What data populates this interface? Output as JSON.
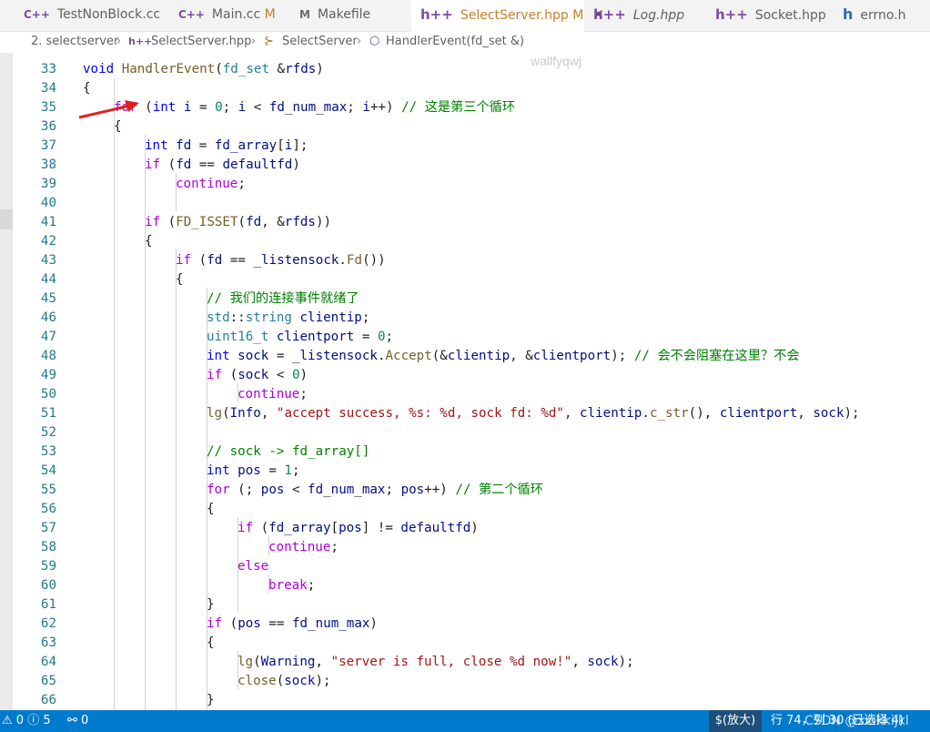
{
  "tabs": [
    {
      "icon": "C++",
      "label": "TestNonBlock.cc",
      "modified": ""
    },
    {
      "icon": "C++",
      "label": "Main.cc",
      "modified": "M"
    },
    {
      "icon": "M",
      "label": "Makefile",
      "modified": ""
    },
    {
      "icon": "h++",
      "label": "SelectServer.hpp",
      "modified": "M",
      "close": "✕"
    },
    {
      "icon": "h++",
      "label": "Log.hpp",
      "modified": ""
    },
    {
      "icon": "h++",
      "label": "Socket.hpp",
      "modified": ""
    },
    {
      "icon": "h",
      "label": "errno.h",
      "modified": ""
    }
  ],
  "breadcrumb": {
    "folder": "2. selectserver",
    "file": "SelectServer.hpp",
    "class": "SelectServer",
    "method": "HandlerEvent(fd_set &)"
  },
  "watermark": "wallfyqwj",
  "code_lines": [
    {
      "num": "33",
      "indent": 2,
      "tokens": [
        [
          "void",
          "k"
        ],
        [
          " ",
          ""
        ],
        [
          "HandlerEvent",
          "fn"
        ],
        [
          "(",
          ""
        ],
        [
          "fd_set",
          "ty"
        ],
        [
          " &",
          ""
        ],
        [
          "rfds",
          "v"
        ],
        [
          ")",
          ""
        ]
      ]
    },
    {
      "num": "34",
      "indent": 2,
      "tokens": [
        [
          "{",
          ""
        ]
      ]
    },
    {
      "num": "35",
      "indent": 3,
      "tokens": [
        [
          "for",
          "ctrl"
        ],
        [
          " (",
          ""
        ],
        [
          "int",
          "k"
        ],
        [
          " ",
          ""
        ],
        [
          "i",
          "v"
        ],
        [
          " = ",
          ""
        ],
        [
          "0",
          "n"
        ],
        [
          "; ",
          ""
        ],
        [
          "i",
          "v"
        ],
        [
          " < ",
          ""
        ],
        [
          "fd_num_max",
          "v"
        ],
        [
          "; ",
          ""
        ],
        [
          "i",
          "v"
        ],
        [
          "++) ",
          ""
        ],
        [
          "// 这是第三个循环",
          "c"
        ]
      ]
    },
    {
      "num": "36",
      "indent": 3,
      "tokens": [
        [
          "{",
          ""
        ]
      ]
    },
    {
      "num": "37",
      "indent": 4,
      "tokens": [
        [
          "int",
          "k"
        ],
        [
          " ",
          ""
        ],
        [
          "fd",
          "v"
        ],
        [
          " = ",
          ""
        ],
        [
          "fd_array",
          "v"
        ],
        [
          "[",
          ""
        ],
        [
          "i",
          "v"
        ],
        [
          "];",
          ""
        ]
      ]
    },
    {
      "num": "38",
      "indent": 4,
      "tokens": [
        [
          "if",
          "ctrl"
        ],
        [
          " (",
          ""
        ],
        [
          "fd",
          "v"
        ],
        [
          " == ",
          ""
        ],
        [
          "defaultfd",
          "v"
        ],
        [
          ")",
          ""
        ]
      ]
    },
    {
      "num": "39",
      "indent": 5,
      "tokens": [
        [
          "continue",
          "ctrl"
        ],
        [
          ";",
          ""
        ]
      ]
    },
    {
      "num": "40",
      "indent": 0,
      "tokens": []
    },
    {
      "num": "41",
      "indent": 4,
      "tokens": [
        [
          "if",
          "ctrl"
        ],
        [
          " (",
          ""
        ],
        [
          "FD_ISSET",
          "fn"
        ],
        [
          "(",
          ""
        ],
        [
          "fd",
          "v"
        ],
        [
          ", &",
          ""
        ],
        [
          "rfds",
          "v"
        ],
        [
          "))",
          ""
        ]
      ]
    },
    {
      "num": "42",
      "indent": 4,
      "tokens": [
        [
          "{",
          ""
        ]
      ]
    },
    {
      "num": "43",
      "indent": 5,
      "tokens": [
        [
          "if",
          "ctrl"
        ],
        [
          " (",
          ""
        ],
        [
          "fd",
          "v"
        ],
        [
          " == ",
          ""
        ],
        [
          "_listensock",
          "v"
        ],
        [
          ".",
          ""
        ],
        [
          "Fd",
          "fn"
        ],
        [
          "())",
          ""
        ]
      ]
    },
    {
      "num": "44",
      "indent": 5,
      "tokens": [
        [
          "{",
          ""
        ]
      ]
    },
    {
      "num": "45",
      "indent": 6,
      "tokens": [
        [
          "// 我们的连接事件就绪了",
          "c"
        ]
      ]
    },
    {
      "num": "46",
      "indent": 6,
      "tokens": [
        [
          "std",
          "ty"
        ],
        [
          "::",
          ""
        ],
        [
          "string",
          "ty"
        ],
        [
          " ",
          ""
        ],
        [
          "clientip",
          "v"
        ],
        [
          ";",
          ""
        ]
      ]
    },
    {
      "num": "47",
      "indent": 6,
      "tokens": [
        [
          "uint16_t",
          "ty"
        ],
        [
          " ",
          ""
        ],
        [
          "clientport",
          "v"
        ],
        [
          " = ",
          ""
        ],
        [
          "0",
          "n"
        ],
        [
          ";",
          ""
        ]
      ]
    },
    {
      "num": "48",
      "indent": 6,
      "tokens": [
        [
          "int",
          "k"
        ],
        [
          " ",
          ""
        ],
        [
          "sock",
          "v"
        ],
        [
          " = ",
          ""
        ],
        [
          "_listensock",
          "v"
        ],
        [
          ".",
          ""
        ],
        [
          "Accept",
          "fn"
        ],
        [
          "(&",
          ""
        ],
        [
          "clientip",
          "v"
        ],
        [
          ", &",
          ""
        ],
        [
          "clientport",
          "v"
        ],
        [
          "); ",
          ""
        ],
        [
          "// 会不会阻塞在这里？不会",
          "c"
        ]
      ]
    },
    {
      "num": "49",
      "indent": 6,
      "tokens": [
        [
          "if",
          "ctrl"
        ],
        [
          " (",
          ""
        ],
        [
          "sock",
          "v"
        ],
        [
          " < ",
          ""
        ],
        [
          "0",
          "n"
        ],
        [
          ")",
          ""
        ]
      ]
    },
    {
      "num": "50",
      "indent": 7,
      "tokens": [
        [
          "continue",
          "ctrl"
        ],
        [
          ";",
          ""
        ]
      ]
    },
    {
      "num": "51",
      "indent": 6,
      "tokens": [
        [
          "lg",
          "fn"
        ],
        [
          "(",
          ""
        ],
        [
          "Info",
          "v"
        ],
        [
          ", ",
          ""
        ],
        [
          "\"accept success, %s: %d, sock fd: %d\"",
          "s"
        ],
        [
          ", ",
          ""
        ],
        [
          "clientip",
          "v"
        ],
        [
          ".",
          ""
        ],
        [
          "c_str",
          "fn"
        ],
        [
          "(), ",
          ""
        ],
        [
          "clientport",
          "v"
        ],
        [
          ", ",
          ""
        ],
        [
          "sock",
          "v"
        ],
        [
          ");",
          ""
        ]
      ]
    },
    {
      "num": "52",
      "indent": 0,
      "tokens": []
    },
    {
      "num": "53",
      "indent": 6,
      "tokens": [
        [
          "// sock -> fd_array[]",
          "c"
        ]
      ]
    },
    {
      "num": "54",
      "indent": 6,
      "tokens": [
        [
          "int",
          "k"
        ],
        [
          " ",
          ""
        ],
        [
          "pos",
          "v"
        ],
        [
          " = ",
          ""
        ],
        [
          "1",
          "n"
        ],
        [
          ";",
          ""
        ]
      ]
    },
    {
      "num": "55",
      "indent": 6,
      "tokens": [
        [
          "for",
          "ctrl"
        ],
        [
          " (; ",
          ""
        ],
        [
          "pos",
          "v"
        ],
        [
          " < ",
          ""
        ],
        [
          "fd_num_max",
          "v"
        ],
        [
          "; ",
          ""
        ],
        [
          "pos",
          "v"
        ],
        [
          "++) ",
          ""
        ],
        [
          "// 第二个循环",
          "c"
        ]
      ]
    },
    {
      "num": "56",
      "indent": 6,
      "tokens": [
        [
          "{",
          ""
        ]
      ]
    },
    {
      "num": "57",
      "indent": 7,
      "tokens": [
        [
          "if",
          "ctrl"
        ],
        [
          " (",
          ""
        ],
        [
          "fd_array",
          "v"
        ],
        [
          "[",
          ""
        ],
        [
          "pos",
          "v"
        ],
        [
          "] != ",
          ""
        ],
        [
          "defaultfd",
          "v"
        ],
        [
          ")",
          ""
        ]
      ]
    },
    {
      "num": "58",
      "indent": 8,
      "tokens": [
        [
          "continue",
          "ctrl"
        ],
        [
          ";",
          ""
        ]
      ]
    },
    {
      "num": "59",
      "indent": 7,
      "tokens": [
        [
          "else",
          "ctrl"
        ]
      ]
    },
    {
      "num": "60",
      "indent": 8,
      "tokens": [
        [
          "break",
          "ctrl"
        ],
        [
          ";",
          ""
        ]
      ]
    },
    {
      "num": "61",
      "indent": 6,
      "tokens": [
        [
          "}",
          ""
        ]
      ]
    },
    {
      "num": "62",
      "indent": 6,
      "tokens": [
        [
          "if",
          "ctrl"
        ],
        [
          " (",
          ""
        ],
        [
          "pos",
          "v"
        ],
        [
          " == ",
          ""
        ],
        [
          "fd_num_max",
          "v"
        ],
        [
          ")",
          ""
        ]
      ]
    },
    {
      "num": "63",
      "indent": 6,
      "tokens": [
        [
          "{",
          ""
        ]
      ]
    },
    {
      "num": "64",
      "indent": 7,
      "tokens": [
        [
          "lg",
          "fn"
        ],
        [
          "(",
          ""
        ],
        [
          "Warning",
          "v"
        ],
        [
          ", ",
          ""
        ],
        [
          "\"server is full, close %d now!\"",
          "s"
        ],
        [
          ", ",
          ""
        ],
        [
          "sock",
          "v"
        ],
        [
          ");",
          ""
        ]
      ]
    },
    {
      "num": "65",
      "indent": 7,
      "tokens": [
        [
          "close",
          "fn"
        ],
        [
          "(",
          ""
        ],
        [
          "sock",
          "v"
        ],
        [
          ");",
          ""
        ]
      ]
    },
    {
      "num": "66",
      "indent": 6,
      "tokens": [
        [
          "}",
          ""
        ]
      ]
    }
  ],
  "status": {
    "warnings": "0",
    "errors": "5",
    "ports": "0",
    "zoom": "$(放大)",
    "position": "行 74，列 30 (已选择 4)",
    "csdn": "CSDN @xxikkijkl"
  },
  "colors": {
    "accent": "#007acc",
    "arrow": "#e02020"
  }
}
